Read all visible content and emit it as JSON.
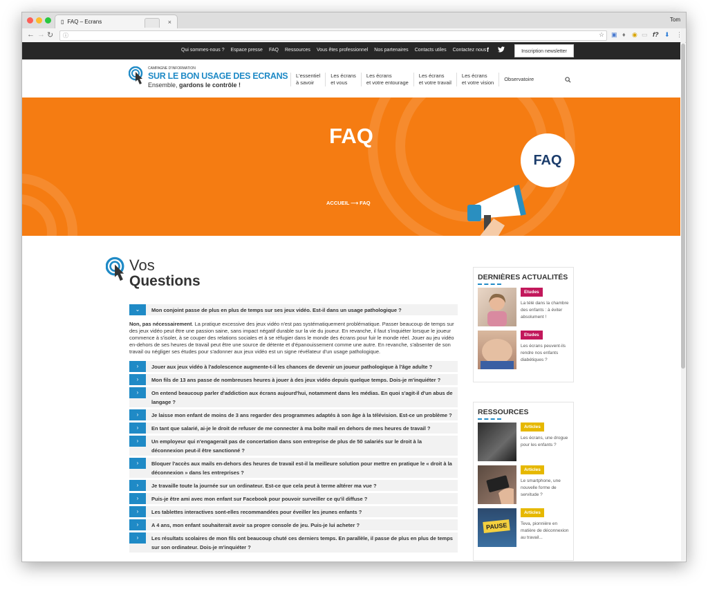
{
  "browser": {
    "tab_title": "FAQ – Ecrans",
    "tab_close": "×",
    "user": "Tom",
    "url_info": "ⓘ"
  },
  "topbar": {
    "links": [
      "Qui sommes-nous ?",
      "Espace presse",
      "FAQ",
      "Ressources",
      "Vous êtes professionnel",
      "Nos partenaires",
      "Contacts utiles",
      "Contactez nous"
    ],
    "facebook": "f",
    "twitter": "🐦",
    "newsletter": "Inscription newsletter"
  },
  "logo": {
    "small": "CAMPAGNE D'INFORMATION",
    "big": "SUR LE BON USAGE DES ECRANS",
    "sub_prefix": "Ensemble, ",
    "sub_bold": "gardons le contrôle !"
  },
  "mainnav": [
    {
      "l1": "L'essentiel",
      "l2": "à savoir"
    },
    {
      "l1": "Les écrans",
      "l2": "et vous"
    },
    {
      "l1": "Les écrans",
      "l2": "et votre entourage"
    },
    {
      "l1": "Les écrans",
      "l2": "et votre travail"
    },
    {
      "l1": "Les écrans",
      "l2": "et votre vision"
    },
    {
      "l1": "Observatoire",
      "l2": ""
    }
  ],
  "hero": {
    "title": "FAQ",
    "crumb_home": "ACCUEIL",
    "crumb_arrow": "⟶",
    "crumb_current": "FAQ",
    "bubble": "FAQ"
  },
  "section": {
    "title_light": "Vos",
    "title_bold": "Questions"
  },
  "faq": {
    "open_question": "Mon conjoint passe de plus en plus de temps sur ses jeux vidéo. Est-il dans un usage pathologique ?",
    "answer_bold": "Non, pas nécessairement",
    "answer_text": ". La pratique excessive des jeux vidéo n'est pas systématiquement problématique. Passer beaucoup de temps sur des jeux vidéo peut être une passion saine, sans impact négatif durable sur la vie du joueur. En revanche, il faut s'inquiéter lorsque le joueur commence à s'isoler, à se couper des relations sociales et à se réfugier dans le monde des écrans pour fuir le monde réel. Jouer au jeu vidéo en-dehors de ses heures de travail peut être une source de détente et d'épanouissement comme une autre. En revanche, s'absenter de son travail ou négliger ses études pour s'adonner aux jeux vidéo est un signe révélateur d'un usage pathologique.",
    "questions": [
      "Jouer aux jeux vidéo à l'adolescence augmente-t-il les chances de devenir un joueur pathologique à l'âge adulte ?",
      "Mon fils de 13 ans passe de nombreuses heures à jouer à des jeux vidéo depuis quelque temps. Dois-je m'inquiéter ?",
      "On entend beaucoup parler d'addiction aux écrans aujourd'hui, notamment dans les médias. En quoi s'agit-il d'un abus de langage ?",
      "Je laisse mon enfant de moins de 3 ans regarder des programmes adaptés à son âge à la télévision. Est-ce un problème ?",
      "En tant que salarié, ai-je le droit de refuser de me connecter à ma boîte mail en dehors de mes heures de travail ?",
      "Un employeur qui n'engagerait pas de concertation dans son entreprise de plus de 50 salariés sur le droit à la déconnexion peut-il être sanctionné ?",
      "Bloquer l'accès aux mails en-dehors des heures de travail est-il la meilleure solution pour mettre en pratique le « droit à la déconnexion » dans les entreprises ?",
      "Je travaille toute la journée sur un ordinateur. Est-ce que cela peut à terme altérer ma vue ?",
      "Puis-je être ami avec mon enfant sur Facebook pour pouvoir surveiller ce qu'il diffuse ?",
      "Les tablettes interactives sont-elles recommandées pour éveiller les jeunes enfants ?",
      "A 4 ans, mon enfant souhaiterait avoir sa propre console de jeu. Puis-je lui acheter ?",
      "Les résultats scolaires de mon fils ont beaucoup chuté ces derniers temps. En parallèle, il passe de plus en plus de temps sur son ordinateur. Dois-je m'inquiéter ?"
    ],
    "toggle_open": "⌄",
    "toggle_closed": "›"
  },
  "sidebar": {
    "news_title": "DERNIÈRES ACTUALITÉS",
    "news": [
      {
        "tag": "Etudes",
        "text": "La télé dans la chambre des enfants : à éviter absolument !"
      },
      {
        "tag": "Etudes",
        "text": "Les écrans peuvent-ils rendre nos enfants diabétiques ?"
      }
    ],
    "res_title": "RESSOURCES",
    "resources": [
      {
        "tag": "Articles",
        "text": "Les écrans, une drogue pour les enfants ?"
      },
      {
        "tag": "Articles",
        "text": "Le smartphone, une nouvelle forme de servitude ?"
      },
      {
        "tag": "Articles",
        "text": "Teva, pionnière en matière de déconnexion au travail..."
      }
    ],
    "pause_sign": "PAUSE"
  },
  "colors": {
    "orange": "#f57c12",
    "blue": "#1f8ac6",
    "etudes": "#c2185b",
    "articles": "#e6b800"
  }
}
